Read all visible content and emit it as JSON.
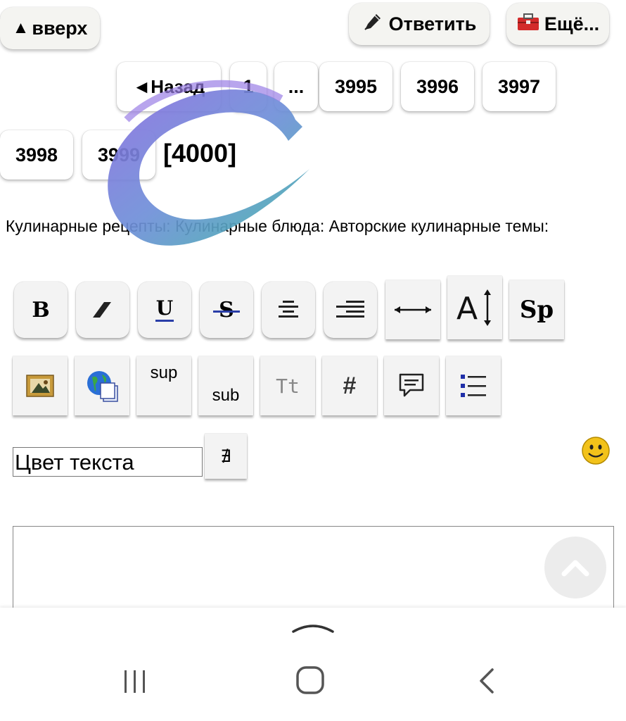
{
  "top": {
    "up_label": "вверх",
    "reply_label": "Ответить",
    "more_label": "Ещё..."
  },
  "pagination": {
    "back_label": "◄Назад",
    "pages_row1": [
      "1",
      "...",
      "3995",
      "3996",
      "3997"
    ],
    "pages_row2": [
      "3998",
      "3999"
    ],
    "current": "[4000]"
  },
  "breadcrumb": "Кулинарные рецепты: Кулинарные блюда: Авторские кулинарные темы:",
  "toolbar": {
    "row1": [
      "bold",
      "italic",
      "underline",
      "strikethrough",
      "align-center",
      "align-right",
      "width",
      "font-size",
      "spoiler"
    ],
    "row2": [
      "image",
      "link",
      "sup",
      "sub",
      "text-type",
      "hash",
      "quote",
      "list"
    ],
    "sup_label": "sup",
    "sub_label": "sub",
    "tt_label": "Tt",
    "sp_label": "Sp",
    "bold_label": "B",
    "underline_label": "U",
    "strike_label": "S"
  },
  "color_select": {
    "value": "Цвет текста"
  },
  "not_symbol": "∄",
  "colors": {
    "accent": "#7b5fd6",
    "teal": "#4cb5a8"
  }
}
